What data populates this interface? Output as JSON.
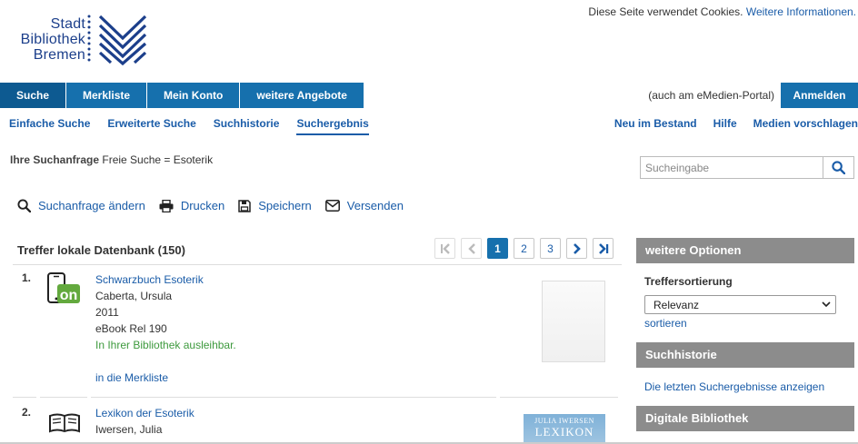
{
  "logo": {
    "line1": "Stadt",
    "line2": "Bibliothek",
    "line3": "Bremen"
  },
  "cookie": {
    "text": "Diese Seite verwendet Cookies. ",
    "link": "Weitere Informationen."
  },
  "main_nav": {
    "items": [
      {
        "label": "Suche"
      },
      {
        "label": "Merkliste"
      },
      {
        "label": "Mein Konto"
      },
      {
        "label": "weitere Angebote"
      }
    ],
    "emedien_note": "(auch am eMedien-Portal)",
    "login": "Anmelden"
  },
  "sub_nav": {
    "left": [
      {
        "label": "Einfache Suche"
      },
      {
        "label": "Erweiterte Suche"
      },
      {
        "label": "Suchhistorie"
      },
      {
        "label": "Suchergebnis"
      }
    ],
    "right": [
      {
        "label": "Neu im Bestand"
      },
      {
        "label": "Hilfe"
      },
      {
        "label": "Medien vorschlagen"
      }
    ]
  },
  "query": {
    "label": "Ihre Suchanfrage",
    "value": " Freie Suche = Esoterik"
  },
  "search": {
    "placeholder": "Sucheingabe",
    "icon": "search-icon"
  },
  "actions": [
    {
      "label": "Suchanfrage ändern",
      "icon": "search-icon"
    },
    {
      "label": "Drucken",
      "icon": "print-icon"
    },
    {
      "label": "Speichern",
      "icon": "save-icon"
    },
    {
      "label": "Versenden",
      "icon": "envelope-icon"
    }
  ],
  "results": {
    "title": "Treffer lokale Datenbank (150)",
    "pager": {
      "pages": [
        "1",
        "2",
        "3"
      ],
      "current": "1"
    },
    "items": [
      {
        "num": "1.",
        "title": "Schwarzbuch Esoterik",
        "author": "Caberta, Ursula",
        "year": "2011",
        "format": "eBook Rel 190",
        "availability": "In Ihrer Bibliothek ausleihbar.",
        "merkliste": "in die Merkliste",
        "icon": "ebook-onleihe-icon"
      },
      {
        "num": "2.",
        "title": "Lexikon der Esoterik",
        "author": "Iwersen, Julia",
        "icon": "book-icon",
        "cover_author": "JULIA IWERSEN",
        "cover_title": "LEXIKON"
      }
    ]
  },
  "sidebar": {
    "options_title": "weitere Optionen",
    "sort_label": "Treffersortierung",
    "sort_value": "Relevanz",
    "sort_link": "sortieren",
    "history_title": "Suchhistorie",
    "history_link": "Die letzten Suchergebnisse anzeigen",
    "digital_title": "Digitale Bibliothek"
  },
  "colors": {
    "primary": "#1670ad",
    "link": "#1a5ca8",
    "available": "#3e9a3e",
    "sidebar_head": "#8c8c8c",
    "logo": "#1c3f8b"
  }
}
